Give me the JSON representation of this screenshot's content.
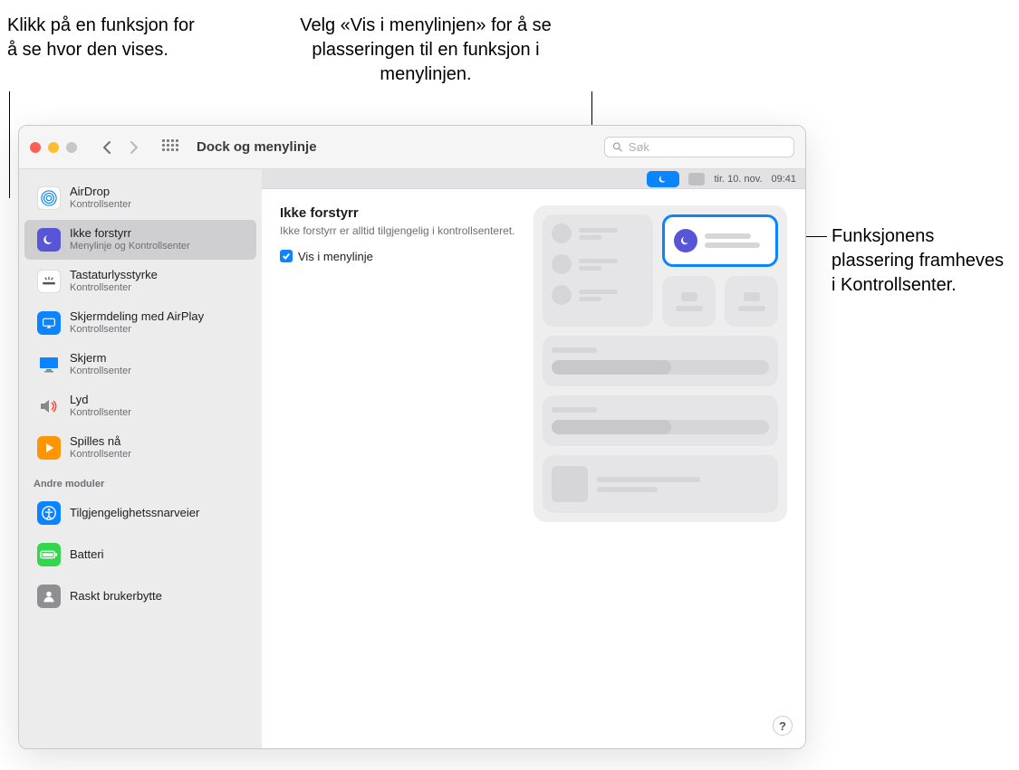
{
  "callouts": {
    "left": "Klikk på en funksjon for å se hvor den vises.",
    "center": "Velg «Vis i menylinjen» for å se plasseringen til en funksjon i menylinjen.",
    "right": "Funksjonens plassering framheves i Kontrollsenter."
  },
  "toolbar": {
    "title": "Dock og menylinje",
    "search_placeholder": "Søk"
  },
  "sidebar": {
    "items": [
      {
        "title": "AirDrop",
        "sub": "Kontrollsenter"
      },
      {
        "title": "Ikke forstyrr",
        "sub": "Menylinje og Kontrollsenter"
      },
      {
        "title": "Tastaturlysstyrke",
        "sub": "Kontrollsenter"
      },
      {
        "title": "Skjermdeling med AirPlay",
        "sub": "Kontrollsenter"
      },
      {
        "title": "Skjerm",
        "sub": "Kontrollsenter"
      },
      {
        "title": "Lyd",
        "sub": "Kontrollsenter"
      },
      {
        "title": "Spilles nå",
        "sub": "Kontrollsenter"
      }
    ],
    "section_header": "Andre moduler",
    "other_items": [
      {
        "title": "Tilgjengelighetssnarveier"
      },
      {
        "title": "Batteri"
      },
      {
        "title": "Raskt brukerbytte"
      }
    ]
  },
  "main": {
    "heading": "Ikke forstyrr",
    "description": "Ikke forstyrr er alltid tilgjengelig i kontrollsenteret.",
    "checkbox_label": "Vis i menylinje",
    "menubar": {
      "date": "tir. 10. nov.",
      "time": "09:41"
    }
  },
  "help_label": "?"
}
